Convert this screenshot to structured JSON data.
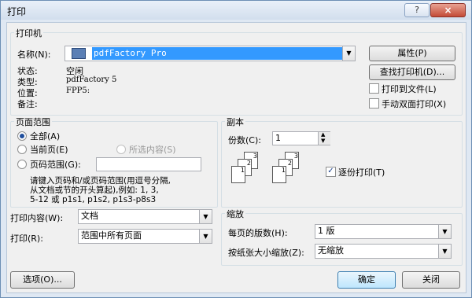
{
  "window": {
    "title": "打印",
    "help": "?",
    "close": "×"
  },
  "printer": {
    "group_title": "打印机",
    "name_label": "名称(N):",
    "name_value": "pdfFactory Pro",
    "properties": "属性(P)",
    "find_printer": "查找打印机(D)...",
    "status_label": "状态:",
    "status_value": "空闲",
    "type_label": "类型:",
    "type_value": "pdfFactory 5",
    "location_label": "位置:",
    "location_value": "FPP5:",
    "comment_label": "备注:",
    "print_to_file": "打印到文件(L)",
    "manual_duplex": "手动双面打印(X)"
  },
  "page_range": {
    "group_title": "页面范围",
    "all": "全部(A)",
    "current": "当前页(E)",
    "selection": "所选内容(S)",
    "pages": "页码范围(G):",
    "pages_value": "",
    "help_text_1": "请键入页码和/或页码范围(用逗号分隔,",
    "help_text_2": "从文档或节的开头算起),例如: 1, 3,",
    "help_text_3": "5-12 或 p1s1, p1s2, p1s3-p8s3"
  },
  "copies": {
    "group_title": "副本",
    "count_label": "份数(C):",
    "count_value": "1",
    "collate": "逐份打印(T)"
  },
  "print_what": {
    "label": "打印内容(W):",
    "value": "文档"
  },
  "print": {
    "label": "打印(R):",
    "value": "范围中所有页面"
  },
  "zoom": {
    "group_title": "缩放",
    "pages_per_sheet_label": "每页的版数(H):",
    "pages_per_sheet_value": "1 版",
    "scale_label": "按纸张大小缩放(Z):",
    "scale_value": "无缩放"
  },
  "footer": {
    "options": "选项(O)...",
    "ok": "确定",
    "cancel": "关闭"
  }
}
